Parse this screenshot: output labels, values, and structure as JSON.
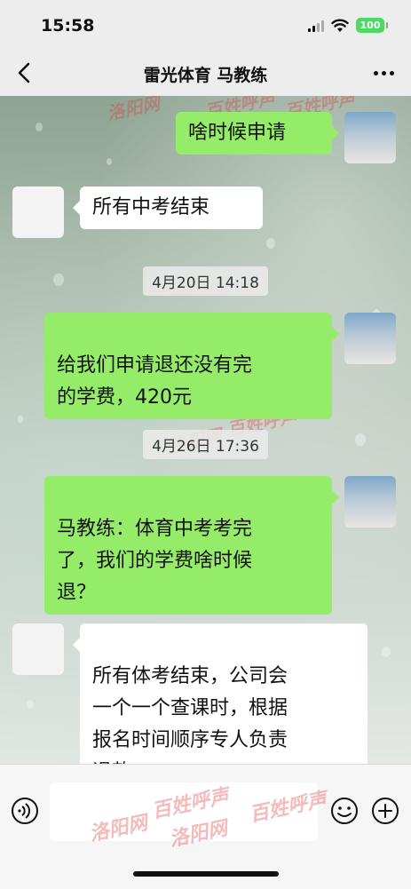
{
  "status_bar": {
    "time": "15:58",
    "battery": "100"
  },
  "nav": {
    "title": "雷光体育  马教练"
  },
  "messages": [
    {
      "sender": "me",
      "text": "啥时候申请"
    },
    {
      "sender": "coach",
      "text": "所有中考结束"
    },
    {
      "timestamp": "4月20日 14:18"
    },
    {
      "sender": "me",
      "text": "给我们申请退还没有完\n的学费，420元"
    },
    {
      "timestamp": "4月26日 17:36"
    },
    {
      "sender": "me",
      "text": "马教练：体育中考考完\n了，我们的学费啥时候\n退？"
    },
    {
      "sender": "coach",
      "text": "所有体考结束，公司会\n一个一个查课时，根据\n报名时间顺序专人负责\n退款"
    }
  ],
  "watermark": {
    "text_cn": "洛阳网",
    "text_cn2": "百姓呼声"
  },
  "colors": {
    "my_bubble": "#95ec69",
    "their_bubble": "#ffffff",
    "battery": "#4cd964"
  },
  "icons": {
    "back": "chevron-left",
    "more": "ellipsis",
    "voice": "voice-wave",
    "emoji": "smiley",
    "plus": "plus-circle"
  }
}
